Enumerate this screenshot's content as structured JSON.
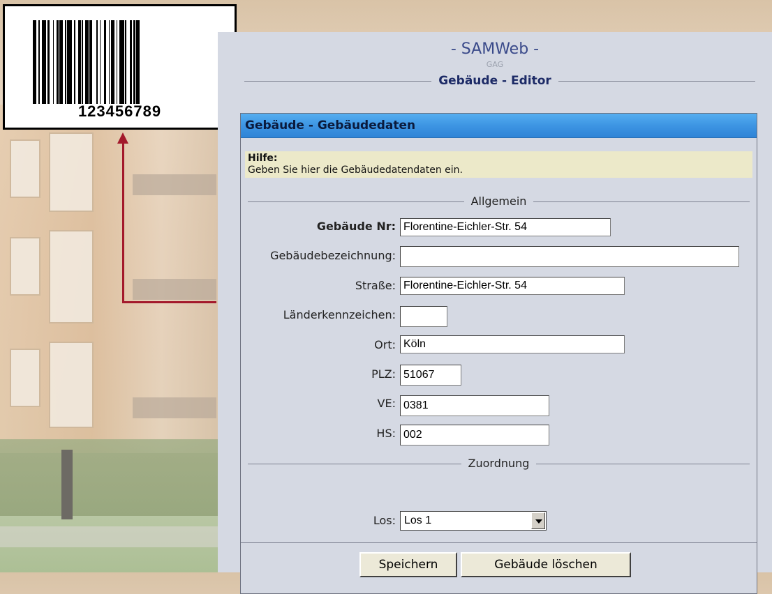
{
  "barcode": {
    "number": "123456789"
  },
  "app": {
    "title": "- SAMWeb -",
    "subtitle": "GAG",
    "editor_title": "Gebäude - Editor"
  },
  "box": {
    "header": "Gebäude - Gebäudedaten",
    "help_title": "Hilfe:",
    "help_text": "Geben Sie hier die Gebäudedatendaten ein."
  },
  "sections": {
    "general": "Allgemein",
    "assignment": "Zuordnung"
  },
  "fields": {
    "gebaeude_nr": {
      "label": "Gebäude Nr:",
      "value": "Florentine-Eichler-Str. 54"
    },
    "bezeichnung": {
      "label": "Gebäudebezeichnung:",
      "value": ""
    },
    "strasse": {
      "label": "Straße:",
      "value": "Florentine-Eichler-Str. 54"
    },
    "laender": {
      "label": "Länderkennzeichen:",
      "value": ""
    },
    "ort": {
      "label": "Ort:",
      "value": "Köln"
    },
    "plz": {
      "label": "PLZ:",
      "value": "51067"
    },
    "ve": {
      "label": "VE:",
      "value": "0381"
    },
    "hs": {
      "label": "HS:",
      "value": "002"
    },
    "los": {
      "label": "Los:",
      "value": "Los 1"
    }
  },
  "buttons": {
    "save": "Speichern",
    "delete": "Gebäude löschen"
  },
  "colors": {
    "arrow": "#a3192b",
    "header": "#3d95e3",
    "help_bg": "#ece9c9",
    "panel_bg": "#d5d9e3"
  }
}
